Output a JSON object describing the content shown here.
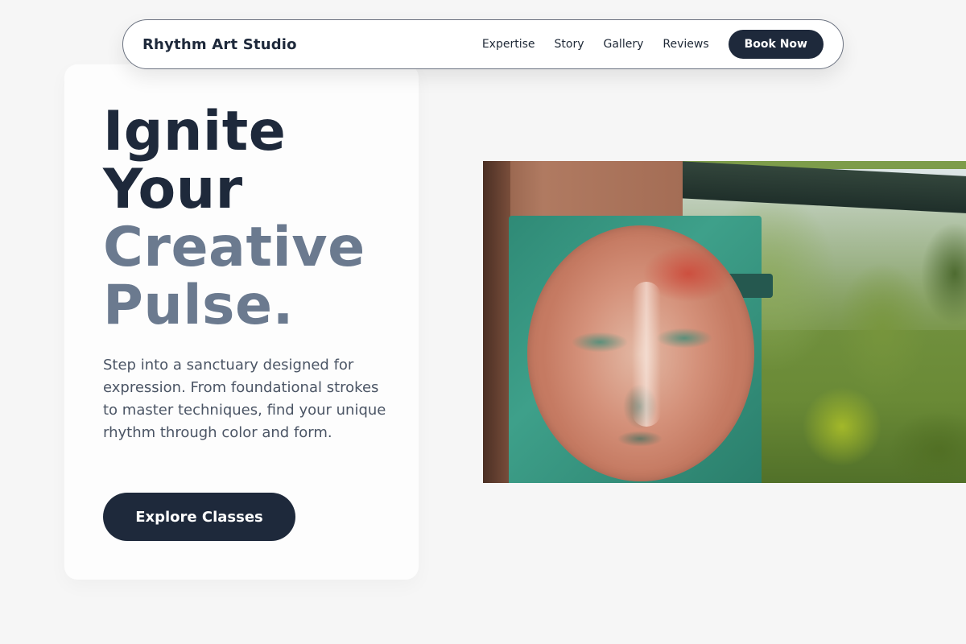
{
  "nav": {
    "brand": "Rhythm Art Studio",
    "links": [
      {
        "label": "Expertise"
      },
      {
        "label": "Story"
      },
      {
        "label": "Gallery"
      },
      {
        "label": "Reviews"
      }
    ],
    "cta_label": "Book Now"
  },
  "hero": {
    "headline": {
      "line1": "Ignite",
      "line2": "Your",
      "line3": "Creative",
      "line4": "Pulse."
    },
    "description": "Step into a sanctuary designed for expression. From foundational strokes to master techniques, find your unique rhythm through color and form.",
    "cta_label": "Explore Classes",
    "image_alt": "Painted face mural on a teal board beside a wooden pillar with green trees in the background"
  },
  "colors": {
    "page_background": "#f6f6f6",
    "primary_dark": "#1e293b",
    "muted_heading": "#6b7a8f",
    "body_text": "#4b5565"
  }
}
